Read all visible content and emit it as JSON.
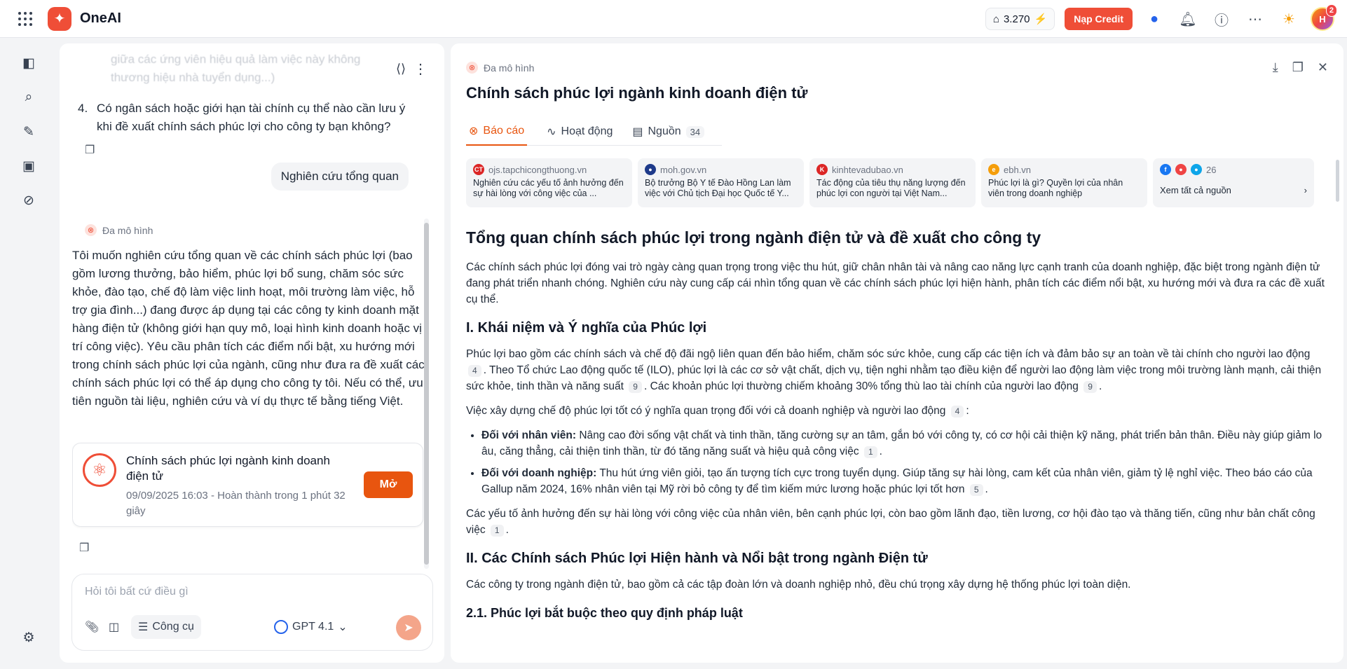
{
  "app": {
    "name": "OneAI"
  },
  "topbar": {
    "credits": "3.270",
    "credit_button": "Nạp Credit",
    "avatar_initials": "H",
    "notification_count": "2"
  },
  "chat": {
    "faded_text_1": "giữa các ứng viên hiệu quả làm việc này không",
    "faded_text_2": "thương hiệu nhà tuyển dụng...)",
    "numbered_item_number": "4.",
    "numbered_item_text": "Có ngân sách hoặc giới hạn tài chính cụ thể nào cần lưu ý khi đề xuất chính sách phúc lợi cho công ty bạn không?",
    "user_message": "Nghiên cứu tổng quan",
    "ai_label": "Đa mô hình",
    "ai_message": "Tôi muốn nghiên cứu tổng quan về các chính sách phúc lợi (bao gồm lương thưởng, bảo hiểm, phúc lợi bổ sung, chăm sóc sức khỏe, đào tạo, chế độ làm việc linh hoạt, môi trường làm việc, hỗ trợ gia đình...) đang được áp dụng tại các công ty kinh doanh mặt hàng điện tử (không giới hạn quy mô, loại hình kinh doanh hoặc vị trí công việc). Yêu cầu phân tích các điểm nổi bật, xu hướng mới trong chính sách phúc lợi của ngành, cũng như đưa ra đề xuất các chính sách phúc lợi có thể áp dụng cho công ty tôi. Nếu có thể, ưu tiên nguồn tài liệu, nghiên cứu và ví dụ thực tế bằng tiếng Việt.",
    "card_title": "Chính sách phúc lợi ngành kinh doanh điện tử",
    "card_subtitle": "09/09/2025 16:03 - Hoàn thành trong 1 phút 32 giây",
    "card_button": "Mở"
  },
  "composer": {
    "placeholder": "Hỏi tôi bất cứ điều gì",
    "tools_label": "Công cụ",
    "model": "GPT 4.1"
  },
  "report": {
    "label": "Đa mô hình",
    "title": "Chính sách phúc lợi ngành kinh doanh điện tử",
    "tabs": [
      {
        "label": "Báo cáo"
      },
      {
        "label": "Hoạt động"
      },
      {
        "label": "Nguồn",
        "count": "34"
      }
    ],
    "sources": [
      {
        "domain": "ojs.tapchicongthuong.vn",
        "fav": "CT",
        "color": "#dc2626",
        "title": "Nghiên cứu các yếu tố ảnh hưởng đến sự hài lòng với công việc của ..."
      },
      {
        "domain": "moh.gov.vn",
        "fav": "●",
        "color": "#1e3a8a",
        "title": "Bộ trưởng Bộ Y tế Đào Hồng Lan làm việc với Chủ tịch Đại học Quốc tế Y..."
      },
      {
        "domain": "kinhtevadubao.vn",
        "fav": "K",
        "color": "#dc2626",
        "title": "Tác động của tiêu thụ năng lượng đến phúc lợi con người tại Việt Nam..."
      },
      {
        "domain": "ebh.vn",
        "fav": "e",
        "color": "#f59e0b",
        "title": "Phúc lợi là gì? Quyền lợi của nhân viên trong doanh nghiệp"
      }
    ],
    "all_sources_count": "26",
    "all_sources_label": "Xem tất cả nguồn",
    "h1": "Tổng quan chính sách phúc lợi trong ngành điện tử và đề xuất cho công ty",
    "intro": "Các chính sách phúc lợi đóng vai trò ngày càng quan trọng trong việc thu hút, giữ chân nhân tài và nâng cao năng lực cạnh tranh của doanh nghiệp, đặc biệt trong ngành điện tử đang phát triển nhanh chóng. Nghiên cứu này cung cấp cái nhìn tổng quan về các chính sách phúc lợi hiện hành, phân tích các điểm nổi bật, xu hướng mới và đưa ra các đề xuất cụ thể.",
    "h2_1": "I. Khái niệm và Ý nghĩa của Phúc lợi",
    "p1_a": "Phúc lợi bao gồm các chính sách và chế độ đãi ngộ liên quan đến bảo hiểm, chăm sóc sức khỏe, cung cấp các tiện ích và đảm bảo sự an toàn về tài chính cho người lao động",
    "p1_c1": "4",
    "p1_b": ". Theo Tổ chức Lao động quốc tế (ILO), phúc lợi là các cơ sở vật chất, dịch vụ, tiện nghi nhằm tạo điều kiện để người lao động làm việc trong môi trường lành mạnh, cải thiện sức khỏe, tinh thần và năng suất",
    "p1_c2": "9",
    "p1_d": ". Các khoản phúc lợi thường chiếm khoảng 30% tổng thù lao tài chính của người lao động",
    "p1_c3": "9",
    "p2": "Việc xây dựng chế độ phúc lợi tốt có ý nghĩa quan trọng đối với cả doanh nghiệp và người lao động",
    "p2_c": "4",
    "b1_label": "Đối với nhân viên:",
    "b1_text": " Nâng cao đời sống vật chất và tinh thần, tăng cường sự an tâm, gắn bó với công ty, có cơ hội cải thiện kỹ năng, phát triển bản thân. Điều này giúp giảm lo âu, căng thẳng, cải thiện tinh thần, từ đó tăng năng suất và hiệu quả công việc",
    "b1_c": "1",
    "b2_label": "Đối với doanh nghiệp:",
    "b2_text": " Thu hút ứng viên giỏi, tạo ấn tượng tích cực trong tuyển dụng. Giúp tăng sự hài lòng, cam kết của nhân viên, giảm tỷ lệ nghỉ việc. Theo báo cáo của Gallup năm 2024, 16% nhân viên tại Mỹ rời bỏ công ty để tìm kiếm mức lương hoặc phúc lợi tốt hơn",
    "b2_c": "5",
    "p3": "Các yếu tố ảnh hưởng đến sự hài lòng với công việc của nhân viên, bên cạnh phúc lợi, còn bao gồm lãnh đạo, tiền lương, cơ hội đào tạo và thăng tiến, cũng như bản chất công việc",
    "p3_c": "1",
    "h2_2": "II. Các Chính sách Phúc lợi Hiện hành và Nổi bật trong ngành Điện tử",
    "p4": "Các công ty trong ngành điện tử, bao gồm cả các tập đoàn lớn và doanh nghiệp nhỏ, đều chú trọng xây dựng hệ thống phúc lợi toàn diện.",
    "h3_1": "2.1. Phúc lợi bắt buộc theo quy định pháp luật"
  }
}
